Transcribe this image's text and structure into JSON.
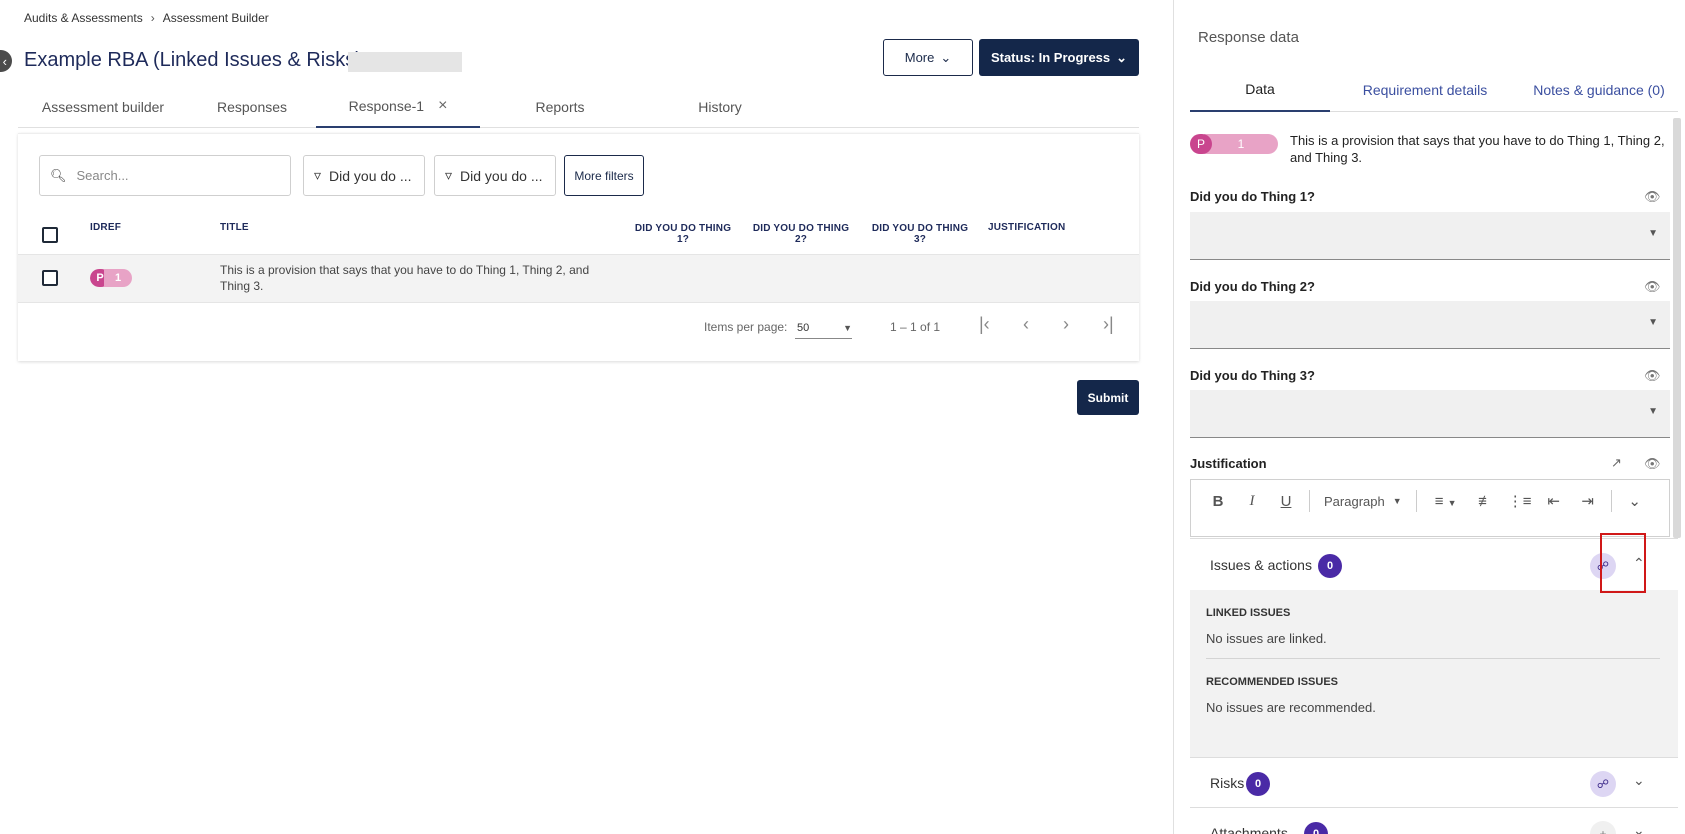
{
  "breadcrumb": {
    "items": [
      "Audits & Assessments",
      "Assessment Builder"
    ]
  },
  "header": {
    "title": "Example RBA (Linked Issues & Risks)",
    "more_label": "More",
    "status_label": "Status: In Progress"
  },
  "tabs": [
    {
      "label": "Assessment builder"
    },
    {
      "label": "Responses"
    },
    {
      "label": "Response-1"
    },
    {
      "label": "Reports"
    },
    {
      "label": "History"
    }
  ],
  "filters": {
    "search_placeholder": "Search...",
    "filter1": "Did you do ...",
    "filter2": "Did you do ...",
    "more_filters": "More filters"
  },
  "table": {
    "columns": [
      "IDREF",
      "TITLE",
      "DID YOU DO THING 1?",
      "DID YOU DO THING 2?",
      "DID YOU DO THING 3?",
      "JUSTIFICATION"
    ],
    "rows": [
      {
        "badge_letter": "P",
        "badge_number": "1",
        "title": "This is a provision that says that you have to do Thing 1, Thing 2, and Thing 3."
      }
    ]
  },
  "pagination": {
    "items_per_page_label": "Items per page:",
    "items_per_page": "50",
    "range": "1 – 1 of 1"
  },
  "submit_label": "Submit",
  "panel": {
    "title": "Response data",
    "tabs": [
      "Data",
      "Requirement details",
      "Notes & guidance (0)"
    ],
    "badge_letter": "P",
    "badge_number": "1",
    "provision": "This is a provision that says that you have to do Thing 1, Thing 2, and Thing 3.",
    "questions": [
      "Did you do Thing 1?",
      "Did you do Thing 2?",
      "Did you do Thing 3?"
    ],
    "justification_label": "Justification",
    "editor_paragraph": "Paragraph",
    "issues": {
      "label": "Issues & actions",
      "count": "0",
      "linked_header": "LINKED ISSUES",
      "linked_text": "No issues are linked.",
      "recommended_header": "RECOMMENDED ISSUES",
      "recommended_text": "No issues are recommended."
    },
    "risks": {
      "label": "Risks",
      "count": "0"
    },
    "attachments": {
      "label": "Attachments",
      "count": "0"
    }
  },
  "colors": {
    "primary_navy": "#14274a",
    "badge_purple": "#4a2aa6",
    "provision_pink": "#c9458e",
    "highlight_red": "#d01818"
  }
}
